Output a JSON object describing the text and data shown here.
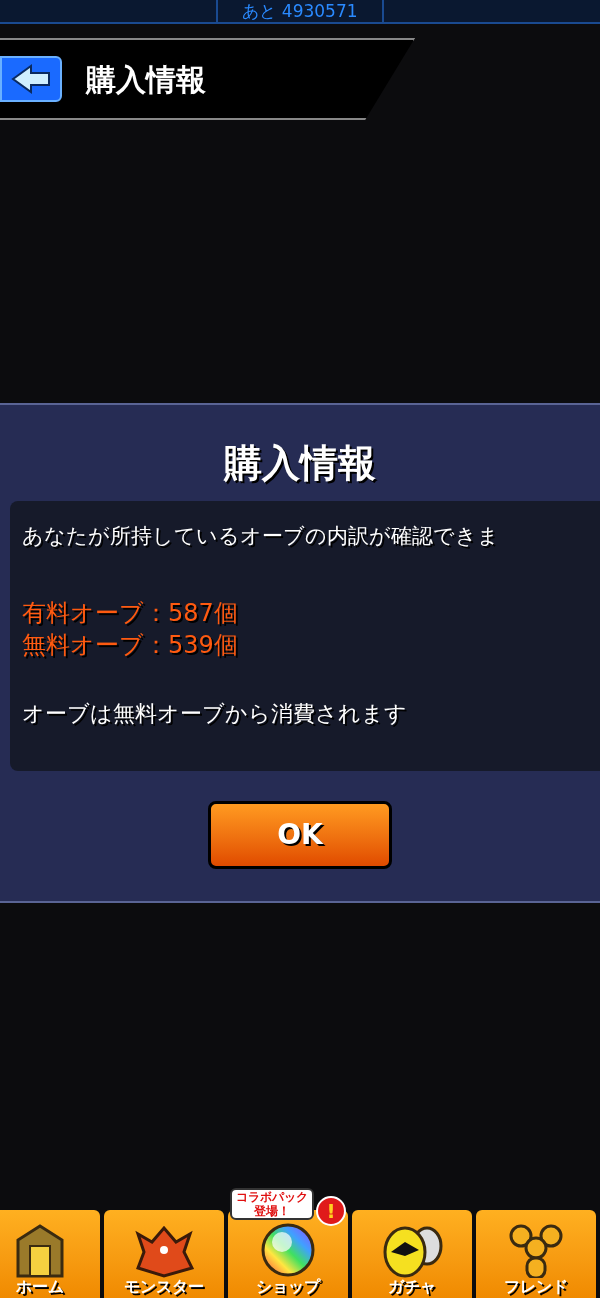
{
  "top_bar": {
    "remaining": "あと 4930571"
  },
  "header": {
    "title": "購入情報"
  },
  "dialog": {
    "title": "購入情報",
    "message": "あなたが所持しているオーブの内訳が確認できま",
    "paid": "有料オーブ：587個",
    "free": "無料オーブ：539個",
    "note": "オーブは無料オーブから消費されます",
    "button": "OK"
  },
  "nav": [
    {
      "label": "ホーム",
      "kind": "home"
    },
    {
      "label": "モンスター",
      "kind": "monster"
    },
    {
      "label": "ショップ",
      "kind": "shop",
      "bubble": [
        "コラボパック",
        "登場！"
      ],
      "alert": "!"
    },
    {
      "label": "ガチャ",
      "kind": "gacha"
    },
    {
      "label": "フレンド",
      "kind": "friend"
    }
  ]
}
